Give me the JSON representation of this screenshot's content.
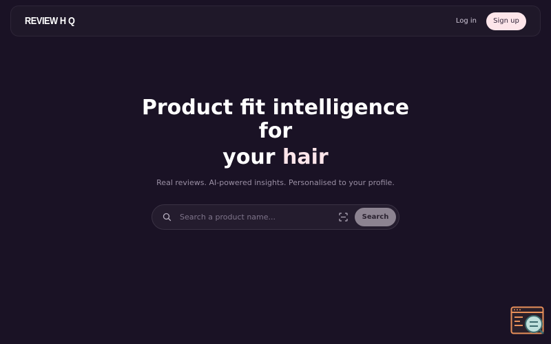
{
  "header": {
    "logo_text": "REVIEW H",
    "logo_q": "Q",
    "login_label": "Log in",
    "signup_label": "Sign up"
  },
  "hero": {
    "title_line1": "Product fit intelligence",
    "title_line2": "for",
    "title_line3_prefix": "your ",
    "title_line3_highlight": "hair",
    "subtitle": "Real reviews. AI-powered insights. Personalised to your profile."
  },
  "search": {
    "placeholder": "Search a product name...",
    "button_label": "Search",
    "left_icon": "search-icon",
    "right_icon": "scan-icon"
  },
  "widget": {
    "icon": "browser-search-icon"
  },
  "colors": {
    "background": "#1a1225",
    "accent": "#fde5ea",
    "search_button": "#8c8391",
    "widget_orange": "#e8905a",
    "widget_teal": "#5fa8a8"
  }
}
